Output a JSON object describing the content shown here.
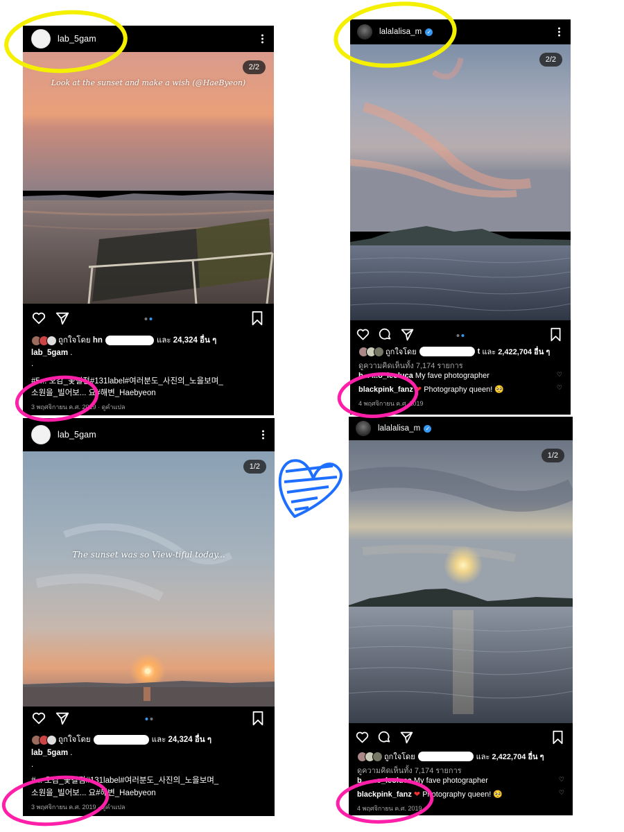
{
  "posts": {
    "top_left": {
      "username": "lab_5gam",
      "counter": "2/2",
      "overlay_text": "Look at the sunset and make a wish (@HaeByeon)",
      "likes_prefix": "ถูกใจโดย",
      "likes_partial": "hn",
      "likes_suffix": "และ",
      "likes_count": "24,324 อื่น ๆ",
      "caption_user": "lab_5gam",
      "caption_dot": ".",
      "caption_dot2": ".",
      "hashtags_line1": "#5... 오감_꽃길점#131label#여러분도_사진의_노을보며_",
      "hashtags_line2": "소원을_빌어보... 요#해변_Haebyeon",
      "date": "3 พฤศจิกายน ค.ศ. 2019",
      "translate": "· ดูคำแปล"
    },
    "bottom_left": {
      "username": "lab_5gam",
      "counter": "1/2",
      "overlay_text": "The sunset was so View-tiful today...",
      "likes_prefix": "ถูกใจโดย",
      "likes_suffix": "และ",
      "likes_count": "24,324 อื่น ๆ",
      "caption_user": "lab_5gam",
      "caption_dot": ".",
      "caption_dot2": ".",
      "hashtags_line1": "#... 오감_꽃길점#131label#여러분도_사진의_노을보며_",
      "hashtags_line2": "소원을_빌어보... 요#해변_Haebyeon",
      "date": "3 พฤศจิกายน ค.ศ. 2019",
      "translate": "· ดูคำแปล"
    },
    "top_right": {
      "username": "lalalalisa_m",
      "counter": "2/2",
      "likes_prefix": "ถูกใจโดย",
      "likes_partial": "t",
      "likes_suffix": "และ",
      "likes_count": "2,422,704 อื่น ๆ",
      "view_comments": "ดูความคิดเห็นทั้ง 7,174 รายการ",
      "comment1_user": "b... ...o_leoluca",
      "comment1_text": "My fave photographer",
      "comment2_user": "blackpink_fanz",
      "comment2_text": "Photography queen! 🥺",
      "date": "4 พฤศจิกายน ค.ศ. 2019"
    },
    "bottom_right": {
      "username": "lalalalisa_m",
      "counter": "1/2",
      "likes_prefix": "ถูกใจโดย",
      "likes_suffix": "และ",
      "likes_count": "2,422,704 อื่น ๆ",
      "view_comments": "ดูความคิดเห็นทั้ง 7,174 รายการ",
      "comment1_user": "b... ...o_leoluca",
      "comment1_text": "My fave photographer",
      "comment2_user": "blackpink_fanz",
      "comment2_text": "Photography queen! 🥺",
      "date": "4 พฤศจิกายน ค.ศ. 2019"
    }
  },
  "icons": [
    "heart-icon",
    "comment-icon",
    "share-icon",
    "bookmark-icon",
    "more-options-icon",
    "verified-badge-icon"
  ],
  "colors": {
    "annotation_yellow": "#f4f000",
    "annotation_pink": "#ff1fa8",
    "annotation_blue": "#1e6fff",
    "verified": "#3897f0",
    "post_bg": "#000000"
  }
}
